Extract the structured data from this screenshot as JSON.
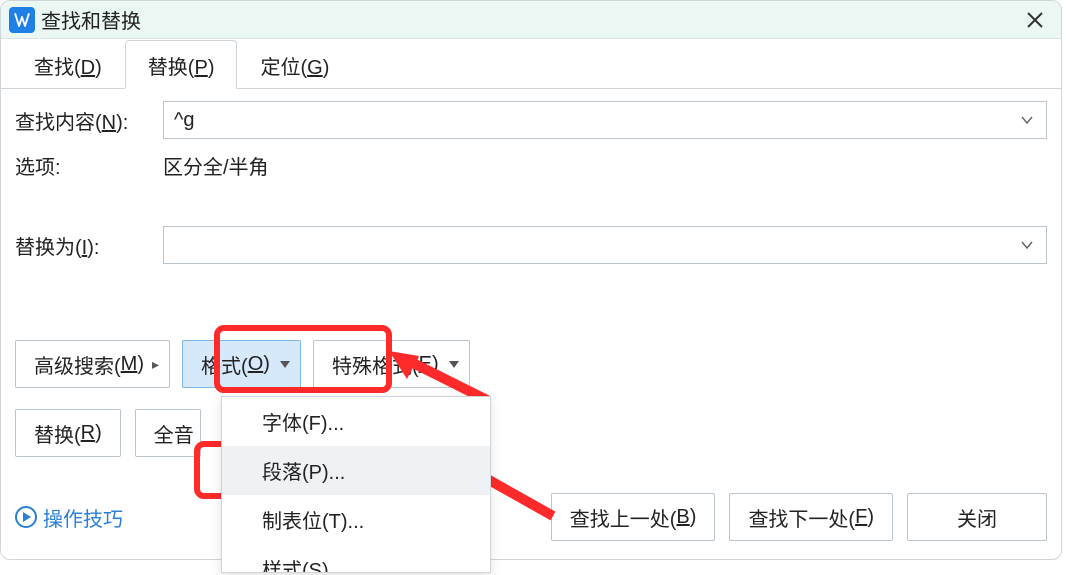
{
  "title": "查找和替换",
  "tabs": {
    "find": {
      "label": "查找(",
      "key": "D",
      "suffix": ")"
    },
    "replace": {
      "label": "替换(",
      "key": "P",
      "suffix": ")"
    },
    "goto": {
      "label": "定位(",
      "key": "G",
      "suffix": ")"
    }
  },
  "find_content": {
    "label_pre": "查找内容(",
    "key": "N",
    "label_suf": "):",
    "value": "^g"
  },
  "options": {
    "label": "选项:",
    "value": "区分全/半角"
  },
  "replace_with": {
    "label_pre": "替换为(",
    "key": "I",
    "label_suf": "):",
    "value": ""
  },
  "buttons": {
    "adv_search": {
      "pre": "高级搜索(",
      "key": "M",
      "suf": ")"
    },
    "format": {
      "pre": "格式(",
      "key": "O",
      "suf": ")"
    },
    "special": {
      "pre": "特殊格式(",
      "key": "E",
      "suf": ")"
    },
    "replace": {
      "pre": "替换(",
      "key": "R",
      "suf": ")"
    },
    "replace_all_partial": "全音",
    "find_prev": {
      "pre": "查找上一处(",
      "key": "B",
      "suf": ")"
    },
    "find_next": {
      "pre": "查找下一处(",
      "key": "F",
      "suf": ")"
    },
    "close": "关闭"
  },
  "menu": {
    "font": "字体(F)...",
    "paragraph": "段落(P)...",
    "tabs": "制表位(T)...",
    "style_partial": "样式(S)"
  },
  "tips": "操作技巧"
}
